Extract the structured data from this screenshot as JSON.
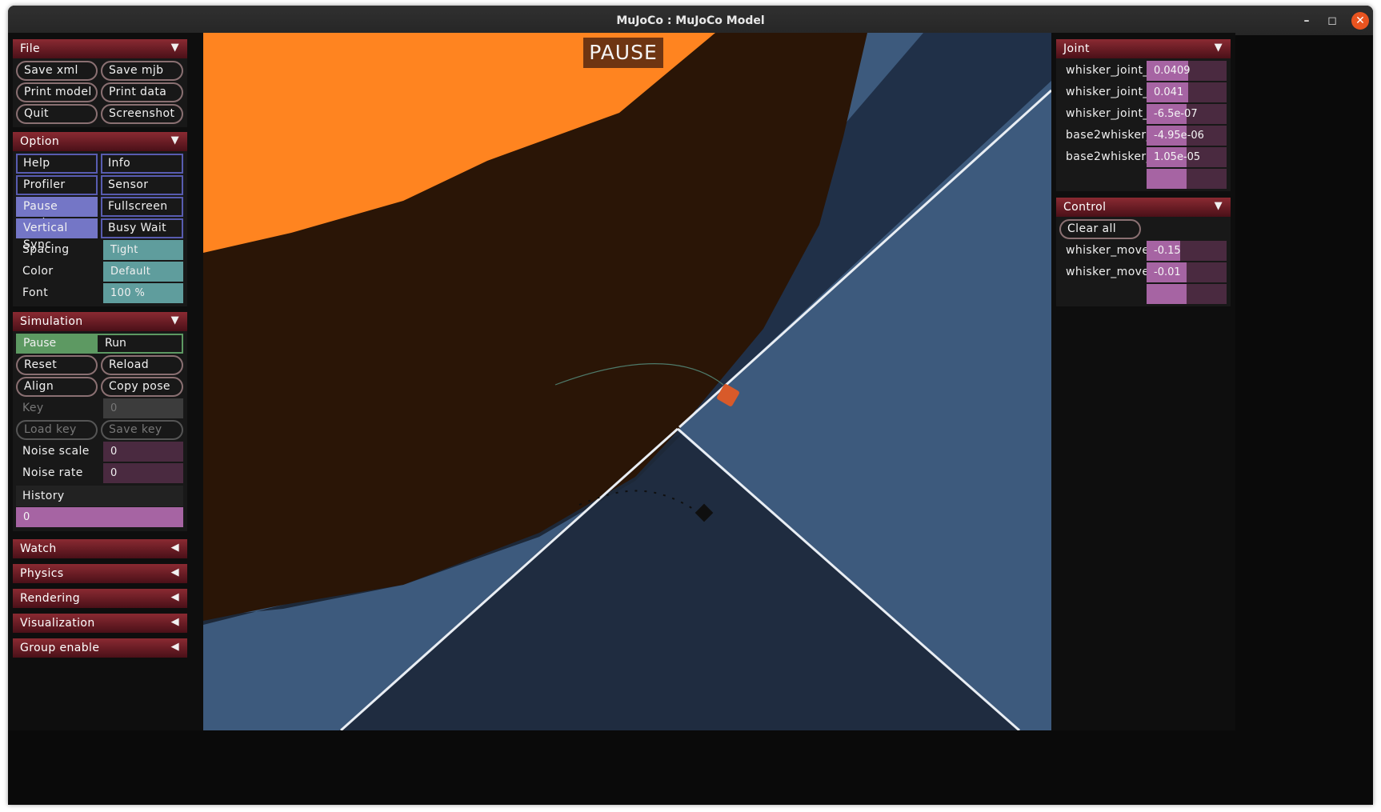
{
  "window": {
    "title": "MuJoCo : MuJoCo Model",
    "controls": {
      "minimize": "–",
      "maximize": "◻",
      "close": "✕"
    }
  },
  "left_panel": {
    "file": {
      "title": "File",
      "arrow": "▼",
      "buttons": [
        "Save xml",
        "Save mjb",
        "Print model",
        "Print data",
        "Quit",
        "Screenshot"
      ]
    },
    "option": {
      "title": "Option",
      "arrow": "▼",
      "checks": [
        {
          "label": "Help",
          "on": false
        },
        {
          "label": "Info",
          "on": false
        },
        {
          "label": "Profiler",
          "on": false
        },
        {
          "label": "Sensor",
          "on": false
        },
        {
          "label": "Pause update",
          "on": true
        },
        {
          "label": "Fullscreen",
          "on": false
        },
        {
          "label": "Vertical Sync",
          "on": true
        },
        {
          "label": "Busy Wait",
          "on": false
        }
      ],
      "spacing_label": "Spacing",
      "spacing_value": "Tight",
      "color_label": "Color",
      "color_value": "Default",
      "font_label": "Font",
      "font_value": "100 %"
    },
    "simulation": {
      "title": "Simulation",
      "arrow": "▼",
      "pause": "Pause",
      "run": "Run",
      "reset": "Reset",
      "reload": "Reload",
      "align": "Align",
      "copy_pose": "Copy pose",
      "key_label": "Key",
      "key_value": "0",
      "load_key": "Load key",
      "save_key": "Save key",
      "noise_scale_label": "Noise scale",
      "noise_scale_value": "0",
      "noise_rate_label": "Noise rate",
      "noise_rate_value": "0",
      "history_label": "History",
      "history_value": "0"
    },
    "collapsed": [
      {
        "title": "Watch",
        "arrow": "◀"
      },
      {
        "title": "Physics",
        "arrow": "◀"
      },
      {
        "title": "Rendering",
        "arrow": "◀"
      },
      {
        "title": "Visualization",
        "arrow": "◀"
      },
      {
        "title": "Group enable",
        "arrow": "◀"
      }
    ]
  },
  "viewport": {
    "status": "PAUSE"
  },
  "right_panel": {
    "joint": {
      "title": "Joint",
      "arrow": "▼",
      "rows": [
        {
          "label": "whisker_joint_",
          "value": "0.0409",
          "fill": 0.52
        },
        {
          "label": "whisker_joint_",
          "value": "0.041",
          "fill": 0.52
        },
        {
          "label": "whisker_joint_",
          "value": "-6.5e-07",
          "fill": 0.5
        },
        {
          "label": "base2whisker_",
          "value": "-4.95e-06",
          "fill": 0.5
        },
        {
          "label": "base2whisker_",
          "value": "1.05e-05",
          "fill": 0.5
        },
        {
          "label": "",
          "value": "",
          "fill": 0.5
        }
      ]
    },
    "control": {
      "title": "Control",
      "arrow": "▼",
      "clear_all": "Clear all",
      "rows": [
        {
          "label": "whisker_move",
          "value": "-0.15",
          "fill": 0.42
        },
        {
          "label": "whisker_move",
          "value": "-0.01",
          "fill": 0.5
        },
        {
          "label": "",
          "value": "",
          "fill": 0.5
        }
      ]
    }
  },
  "colors": {
    "section_header": "#6a1c24",
    "checkbox_on": "#7476c6",
    "select": "#5f9d9d",
    "slider_fill": "#a664a3",
    "radio_on": "#5d9962",
    "floor_blue": "#3d5a7d",
    "object_orange": "#ff8420",
    "shadow_brown": "#2a1506"
  }
}
